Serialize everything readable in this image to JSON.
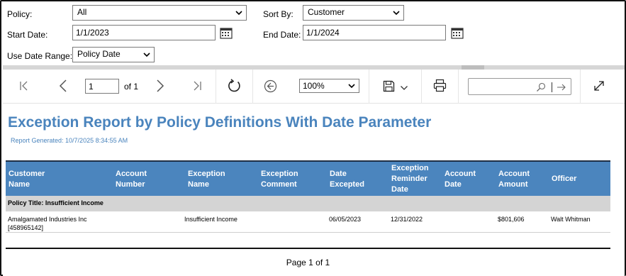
{
  "params": {
    "policy_label": "Policy:",
    "policy_value": "All",
    "sort_label": "Sort By:",
    "sort_value": "Customer",
    "start_label": "Start Date:",
    "start_value": "1/1/2023",
    "end_label": "End Date:",
    "end_value": "1/1/2024",
    "range_label": "Use Date Range:",
    "range_value": "Policy Date"
  },
  "toolbar": {
    "page_value": "1",
    "of_text": "of 1",
    "zoom_value": "100%"
  },
  "report": {
    "title": "Exception Report by Policy Definitions With Date Parameter",
    "generated": "Report Generated: 10/7/2025 8:34:55 AM",
    "headers": {
      "customer_name_1": "Customer",
      "customer_name_2": "Name",
      "account_number_1": "Account",
      "account_number_2": "Number",
      "exception_name_1": "Exception",
      "exception_name_2": "Name",
      "exception_comment_1": "Exception",
      "exception_comment_2": "Comment",
      "date_excepted_1": "Date",
      "date_excepted_2": "Excepted",
      "reminder_1": "Exception",
      "reminder_2": "Reminder",
      "reminder_3": "Date",
      "account_date_1": "Account",
      "account_date_2": "Date",
      "account_amount_1": "Account",
      "account_amount_2": "Amount",
      "officer": "Officer"
    },
    "group_title": "Policy Title: Insufficient Income",
    "row": {
      "customer_1": "Amalgamated Industries Inc",
      "customer_2": "[458965142]",
      "exception_name": "Insufficient Income",
      "date_excepted": "06/05/2023",
      "reminder_date": "12/31/2022",
      "account_amount": "$801,606",
      "officer": "Walt Whitman"
    },
    "page_footer": "Page 1 of 1"
  },
  "colors": {
    "title_blue": "#4a84bd",
    "header_blue": "#4b85be",
    "group_gray": "#d4d4d4"
  }
}
